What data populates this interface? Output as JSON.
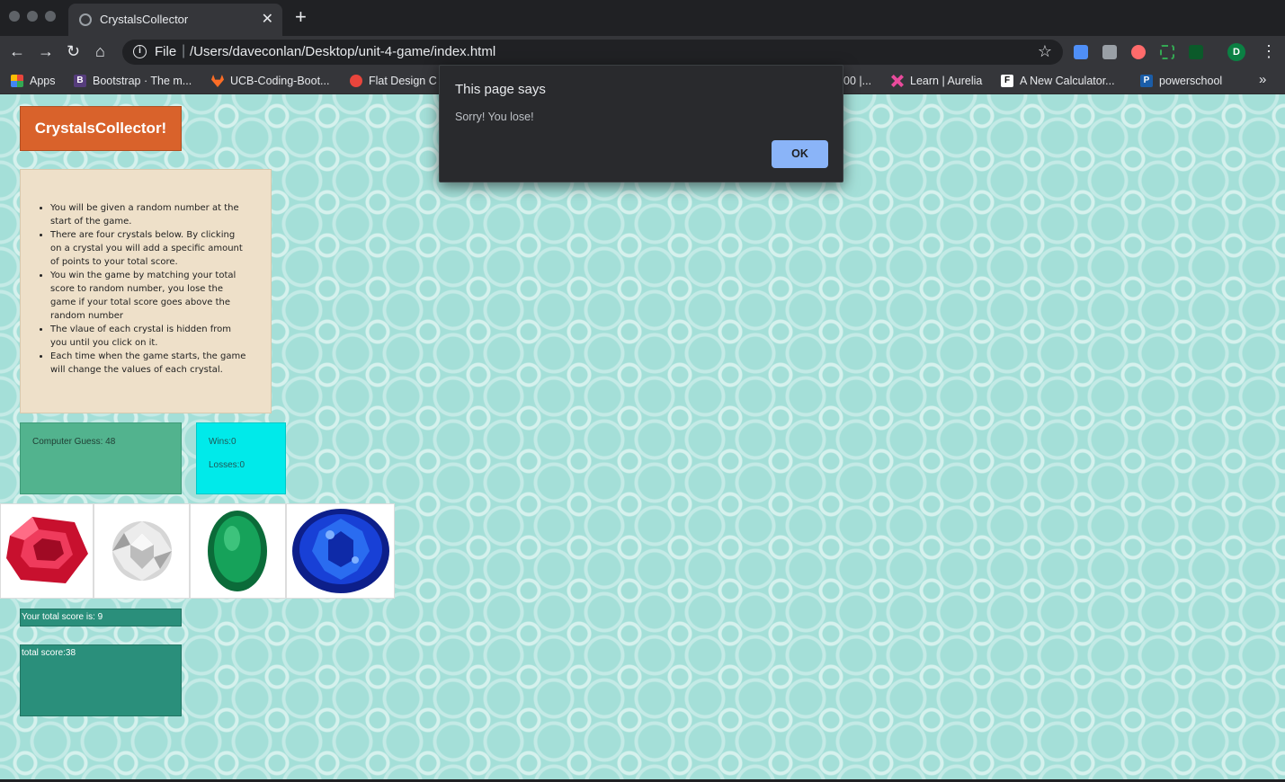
{
  "browser": {
    "tab_title": "CrystalsCollector",
    "new_tab_symbol": "+",
    "close_symbol": "✕",
    "omnibox_scheme": "File",
    "omnibox_url": "/Users/daveconlan/Desktop/unit-4-game/index.html",
    "profile_initial": "D",
    "bookmarks_overflow": "»",
    "bookmarks": [
      {
        "label": "Apps",
        "icon": "apps-grid-icon",
        "color": "#e8453c"
      },
      {
        "label": "Bootstrap · The m...",
        "icon": "bootstrap-icon",
        "color": "#563d7c",
        "glyph": "B"
      },
      {
        "label": "UCB-Coding-Boot...",
        "icon": "gitlab-icon",
        "color": "#fc6d26"
      },
      {
        "label": "Flat Design C",
        "icon": "flat-design-icon",
        "color": "#e8453c"
      },
      {
        "label": "00 |...",
        "icon": "",
        "color": ""
      },
      {
        "label": "Learn | Aurelia",
        "icon": "aurelia-icon",
        "color": "#e94b9c"
      },
      {
        "label": "A New Calculator...",
        "icon": "freecodecamp-icon",
        "color": "#ffffff",
        "glyph": "F"
      },
      {
        "label": "powerschool",
        "icon": "powerschool-icon",
        "color": "#1b5da8",
        "glyph": "P"
      }
    ]
  },
  "page": {
    "title_button": "CrystalsCollector!",
    "instructions": [
      "You will be given a random number at the start of the game.",
      "There are four crystals below. By clicking on a crystal you will add a specific amount of points to your total score.",
      "You win the game by matching your total score to random number, you lose the game if your total score goes above the random number",
      "The vlaue of each crystal is hidden from you until you click on it.",
      "Each time when the game starts, the game will change the values of each crystal."
    ],
    "computer_guess": "Computer Guess: 48",
    "wins": "Wins:0",
    "losses": "Losses:0",
    "crystals": [
      {
        "name": "ruby",
        "color": "#c8102e"
      },
      {
        "name": "diamond",
        "color": "#d9d9d9"
      },
      {
        "name": "emerald",
        "color": "#0f8a4a"
      },
      {
        "name": "sapphire",
        "color": "#1336b8"
      }
    ],
    "your_total_score": "Your total score is: 9",
    "total_score": "total score:38"
  },
  "dialog": {
    "title": "This page says",
    "message": "Sorry! You lose!",
    "ok_label": "OK"
  },
  "colors": {
    "page_background": "#a4dfd8",
    "title_button": "#d9622b",
    "instructions_panel": "#eee0c9",
    "guess_box": "#52b38e",
    "stats_box": "#00eaea",
    "score_boxes": "#2a8f7b",
    "dialog_button": "#8ab4f8"
  }
}
